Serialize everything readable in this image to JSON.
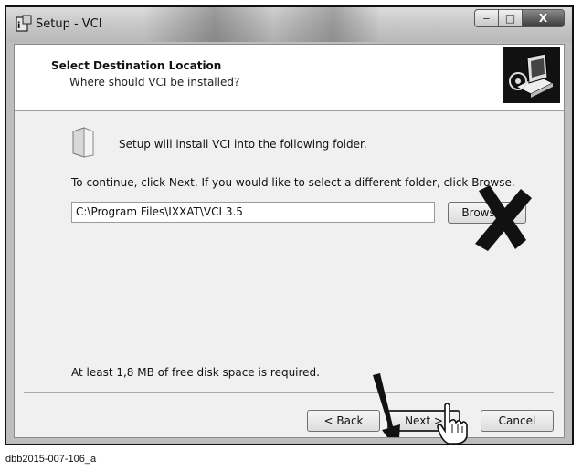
{
  "window": {
    "title": "Setup - VCI",
    "minimize_label": "‒",
    "maximize_label": "□",
    "close_label": "X"
  },
  "header": {
    "title": "Select Destination Location",
    "subtitle": "Where should VCI be installed?"
  },
  "body": {
    "info_line": "Setup will install VCI into the following folder.",
    "instructions": "To continue, click Next. If you would like to select a different folder, click Browse.",
    "path_value": "C:\\Program Files\\IXXAT\\VCI 3.5",
    "browse_label": "Browse...",
    "disk_space": "At least 1,8 MB of free disk space is required."
  },
  "footer": {
    "back_label": "< Back",
    "next_label": "Next >",
    "cancel_label": "Cancel"
  },
  "caption": "dbb2015-007-106_a"
}
